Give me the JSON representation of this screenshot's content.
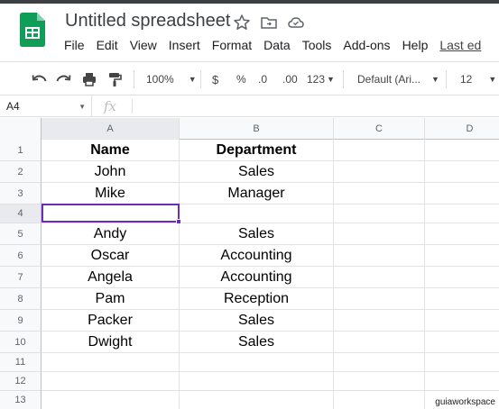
{
  "document": {
    "title": "Untitled spreadsheet"
  },
  "menu": [
    {
      "label": "File"
    },
    {
      "label": "Edit"
    },
    {
      "label": "View"
    },
    {
      "label": "Insert"
    },
    {
      "label": "Format"
    },
    {
      "label": "Data"
    },
    {
      "label": "Tools"
    },
    {
      "label": "Add-ons"
    },
    {
      "label": "Help"
    },
    {
      "label": "Last ed"
    }
  ],
  "toolbar": {
    "zoom": "100%",
    "currency": "$",
    "percent": "%",
    "decrease_decimal": ".0",
    "increase_decimal": ".00",
    "more_formats": "123",
    "font": "Default (Ari...",
    "font_size": "12"
  },
  "formula_bar": {
    "name_box": "A4",
    "fx_label": "fx"
  },
  "columns": [
    "A",
    "B",
    "C",
    "D"
  ],
  "rows": [
    {
      "num": "1",
      "a": "Name",
      "b": "Department"
    },
    {
      "num": "2",
      "a": "John",
      "b": "Sales"
    },
    {
      "num": "3",
      "a": "Mike",
      "b": "Manager"
    },
    {
      "num": "4",
      "a": "",
      "b": ""
    },
    {
      "num": "5",
      "a": "Andy",
      "b": "Sales"
    },
    {
      "num": "6",
      "a": "Oscar",
      "b": "Accounting"
    },
    {
      "num": "7",
      "a": "Angela",
      "b": "Accounting"
    },
    {
      "num": "8",
      "a": "Pam",
      "b": "Reception"
    },
    {
      "num": "9",
      "a": "Packer",
      "b": "Sales"
    },
    {
      "num": "10",
      "a": "Dwight",
      "b": "Sales"
    },
    {
      "num": "11",
      "a": "",
      "b": ""
    },
    {
      "num": "12",
      "a": "",
      "b": ""
    },
    {
      "num": "13",
      "a": "",
      "b": ""
    }
  ],
  "selection": {
    "cell": "A4",
    "color": "#6c2eb9"
  },
  "colors": {
    "sheets_green": "#0f9d58",
    "selection": "#6c2eb9"
  },
  "watermark": "guiaworkspace"
}
